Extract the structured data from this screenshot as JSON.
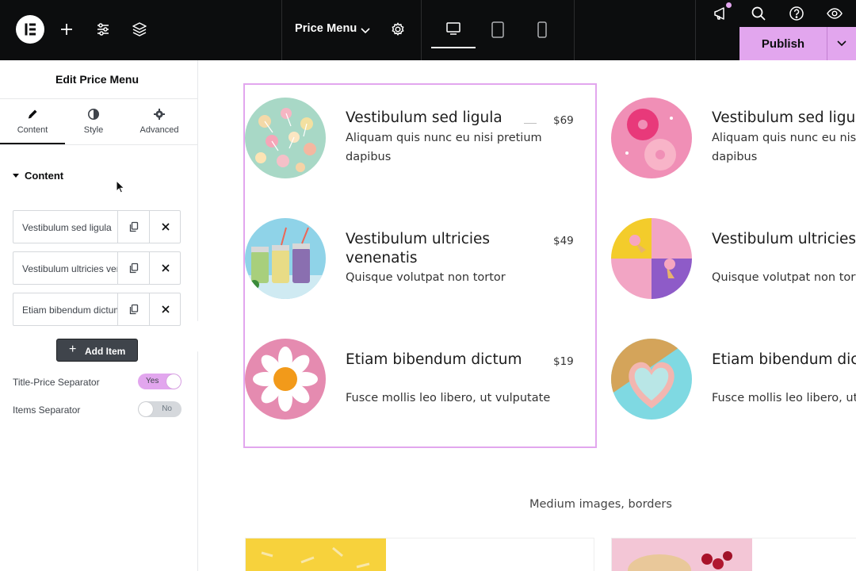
{
  "topbar": {
    "doc_title": "Price Menu",
    "publish_label": "Publish",
    "icons": [
      "elementor-logo-icon",
      "add-icon",
      "site-settings-icon",
      "layers-icon",
      "settings-gear-icon",
      "desktop-icon",
      "tablet-icon",
      "mobile-icon",
      "whats-new-icon",
      "search-icon",
      "help-icon",
      "preview-eye-icon",
      "chevron-down-icon"
    ]
  },
  "panel": {
    "title": "Edit Price Menu",
    "tabs": [
      {
        "label": "Content",
        "icon": "pencil-icon"
      },
      {
        "label": "Style",
        "icon": "contrast-icon"
      },
      {
        "label": "Advanced",
        "icon": "gear-icon"
      }
    ],
    "section_title": "Content",
    "items": [
      {
        "label": "Vestibulum sed ligula"
      },
      {
        "label": "Vestibulum ultricies venenatis"
      },
      {
        "label": "Etiam bibendum dictum"
      }
    ],
    "add_item_label": "Add Item",
    "title_price_separator": {
      "label": "Title-Price Separator",
      "state": "Yes"
    },
    "items_separator": {
      "label": "Items Separator",
      "state": "No"
    }
  },
  "canvas": {
    "menu_left": [
      {
        "title": "Vestibulum sed ligula",
        "desc": "Aliquam quis nunc eu nisi pretium dapibus",
        "price": "$69"
      },
      {
        "title": "Vestibulum ultricies venenatis",
        "desc": "Quisque volutpat non tortor",
        "price": "$49"
      },
      {
        "title": "Etiam bibendum dictum",
        "desc": "Fusce mollis leo libero, ut vulputate",
        "price": "$19"
      }
    ],
    "menu_right": [
      {
        "title": "Vestibulum sed ligula",
        "desc": "Aliquam quis nunc eu nisi pretium dapibus"
      },
      {
        "title": "Vestibulum ultricies venenatis",
        "desc": "Quisque volutpat non tortor"
      },
      {
        "title": "Etiam bibendum dictum",
        "desc": "Fusce mollis leo libero, ut vulputate"
      }
    ],
    "section_caption": "Medium images, borders"
  },
  "colors": {
    "accent": "#e2a6ee",
    "topbar_bg": "#0c0d0e",
    "panel_text": "#3f444b"
  }
}
